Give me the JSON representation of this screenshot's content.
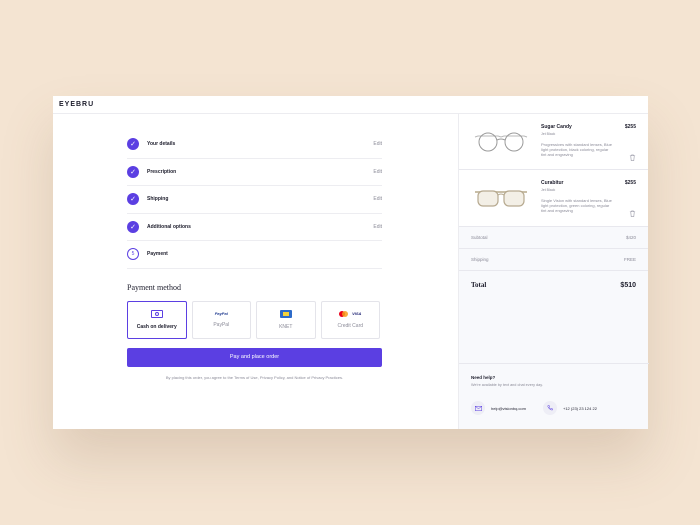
{
  "brand": {
    "logo": "EYEBRU"
  },
  "steps": [
    {
      "label": "Your details",
      "edit": "Edit",
      "done": true
    },
    {
      "label": "Prescription",
      "edit": "Edit",
      "done": true
    },
    {
      "label": "Shipping",
      "edit": "Edit",
      "done": true
    },
    {
      "label": "Additional options",
      "edit": "Edit",
      "done": true
    },
    {
      "label": "Payment",
      "number": "5",
      "done": false
    }
  ],
  "payment": {
    "title": "Payment method",
    "options": [
      {
        "label": "Cash on delivery",
        "icon": "cash-icon",
        "selected": true
      },
      {
        "label": "PayPal",
        "logo": "PayPal",
        "icon": "paypal-icon",
        "selected": false
      },
      {
        "label": "KNET",
        "icon": "knet-icon",
        "selected": false
      },
      {
        "label": "Credit Card",
        "logo": "VISA",
        "icon": "credit-card-icon",
        "selected": false
      }
    ],
    "button": "Pay and place order",
    "terms": "By placing this order, you agree to the Terms of Use, Privacy Policy, and Notice of Privacy Practices."
  },
  "cart": {
    "items": [
      {
        "name": "Sugar Candy",
        "variant": "Jet Black",
        "description": "Progressives with standard lenses, Blue light protection, black coloring, regular tint and engraving",
        "price": "$255"
      },
      {
        "name": "Curabitur",
        "variant": "Jet Black",
        "description": "Single Vision with standard lenses, Blue light protection, green coloring, regular tint and engraving",
        "price": "$255"
      }
    ],
    "subtotal_label": "Subtotal",
    "subtotal": "$420",
    "shipping_label": "Shipping",
    "shipping": "FREE",
    "total_label": "Total",
    "total": "$510"
  },
  "help": {
    "title": "Need help?",
    "subtitle": "We're available by text and chat every day.",
    "email": "help@visionbq.com",
    "phone": "+12 (23) 23 124 22"
  },
  "colors": {
    "accent": "#5b3fe2",
    "background": "#f4e4d2"
  }
}
